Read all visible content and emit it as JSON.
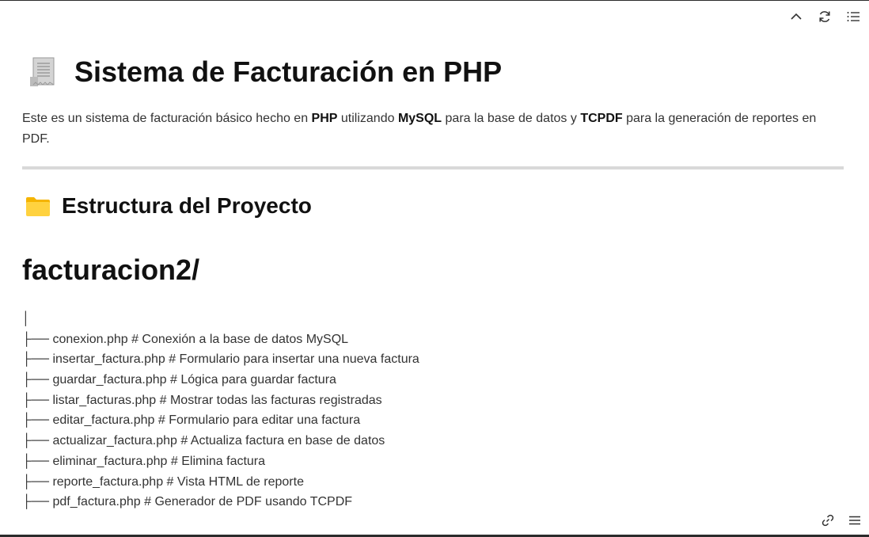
{
  "toolbar": {
    "top_icons": [
      "chevron-up-icon",
      "refresh-icon",
      "list-icon"
    ],
    "bottom_icons": [
      "link-icon",
      "menu-icon"
    ]
  },
  "doc": {
    "title": "Sistema de Facturación en PHP",
    "title_icon": "receipt-icon",
    "description": {
      "part1": "Este es un sistema de facturación básico hecho en ",
      "php": "PHP",
      "part2": " utilizando ",
      "mysql": "MySQL",
      "part3": " para la base de datos y ",
      "tcpdf": "TCPDF",
      "part4": " para la generación de reportes en PDF."
    },
    "section_title": "Estructura del Proyecto",
    "section_icon": "folder-icon",
    "dir_heading": "facturacion2/",
    "tree": [
      "│",
      "├── conexion.php # Conexión a la base de datos MySQL",
      "├── insertar_factura.php # Formulario para insertar una nueva factura",
      "├── guardar_factura.php # Lógica para guardar factura",
      "├── listar_facturas.php # Mostrar todas las facturas registradas",
      "├── editar_factura.php # Formulario para editar una factura",
      "├── actualizar_factura.php # Actualiza factura en base de datos",
      "├── eliminar_factura.php # Elimina factura",
      "├── reporte_factura.php # Vista HTML de reporte",
      "├── pdf_factura.php # Generador de PDF usando TCPDF"
    ]
  }
}
